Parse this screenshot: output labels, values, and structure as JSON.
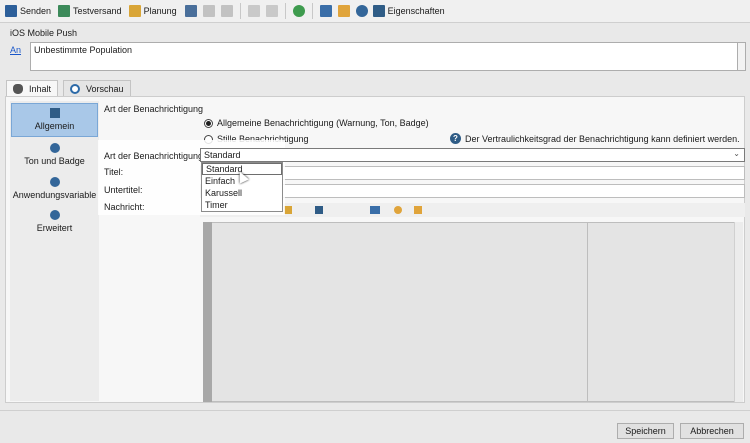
{
  "toolbar": {
    "send": "Senden",
    "test_send": "Testversand",
    "schedule": "Planung",
    "properties": "Eigenschaften"
  },
  "header": {
    "title": "iOS Mobile Push",
    "to_link": "An",
    "to_value": "Unbestimmte Population"
  },
  "tabs": [
    {
      "label": "Inhalt"
    },
    {
      "label": "Vorschau"
    }
  ],
  "sidebar": {
    "items": [
      {
        "label": "Allgemein"
      },
      {
        "label": "Ton und Badge"
      },
      {
        "label": "Anwendungsvariable"
      },
      {
        "label": "Erweitert"
      }
    ]
  },
  "content": {
    "section_title": "Art der Benachrichtigung",
    "radio_general": "Allgemeine Benachrichtigung (Warnung, Ton, Badge)",
    "radio_silent": "Stille Benachrichtigung",
    "help_text": "Der Vertraulichkeitsgrad der Benachrichtigung kann definiert werden.",
    "type_label": "Art der Benachrichtigung:",
    "type_value": "Standard",
    "title_label": "Titel:",
    "subtitle_label": "Untertitel:",
    "message_label": "Nachricht:"
  },
  "dropdown": {
    "options": [
      "Standard",
      "Einfach",
      "Karussell",
      "Timer"
    ]
  },
  "footer": {
    "save": "Speichern",
    "cancel": "Abbrechen"
  },
  "colors": {
    "accent_selected": "#a9c8e8",
    "link": "#1a57c9"
  }
}
